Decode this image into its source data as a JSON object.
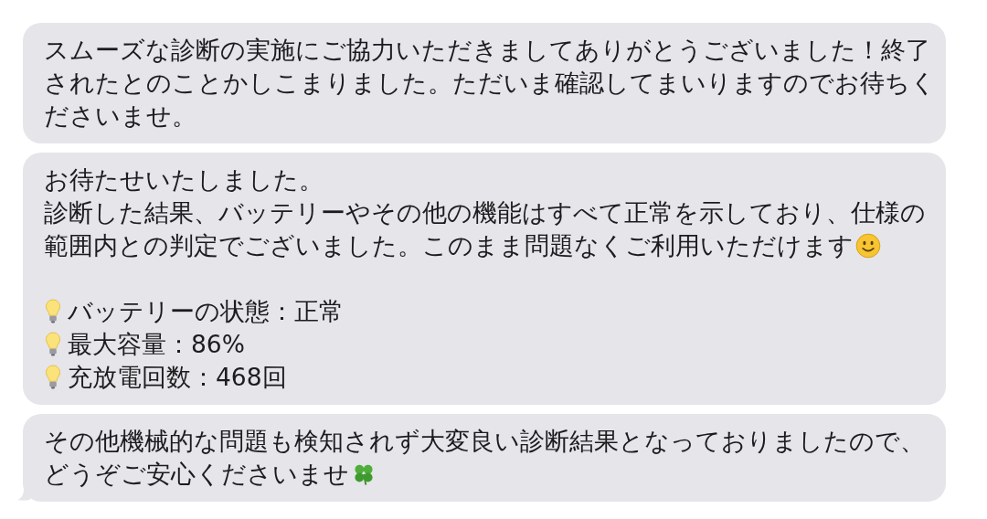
{
  "messages": [
    {
      "tail": false,
      "paragraphs": [
        {
          "lines": [
            "スムーズな診断の実施にご協力いただきましてありがとうございました！終了",
            "されたとのことかしこまりました。ただいま確認してまいりますのでお待ちく",
            "ださいませ。"
          ]
        }
      ]
    },
    {
      "tail": false,
      "paragraphs": [
        {
          "lines": [
            "お待たせいたしました。",
            "診断した結果、バッテリーやその他の機能はすべて正常を示しており、仕様の",
            "範囲内との判定でございました。このまま問題なくご利用いただけます"
          ]
        }
      ],
      "items": [
        {
          "text": "バッテリーの状態：正常"
        },
        {
          "text": "最大容量：86%"
        },
        {
          "text": "充放電回数：468回"
        }
      ]
    },
    {
      "tail": true,
      "paragraphs": [
        {
          "lines": [
            "その他機械的な問題も検知されず大変良い診断結果となっておりましたので、",
            "どうぞご安心くださいませ"
          ]
        }
      ]
    }
  ]
}
